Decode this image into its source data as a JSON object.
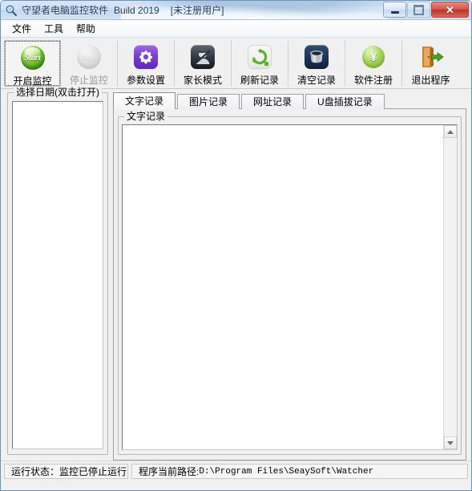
{
  "window": {
    "title": "守望者电脑监控软件",
    "build": "Build 2019",
    "registration": "[未注册用户]",
    "icon": "magnifier-icon",
    "caption": {
      "minimize": "—",
      "maximize": "□",
      "close": "✕"
    }
  },
  "menu": {
    "items": [
      {
        "label": "文件"
      },
      {
        "label": "工具"
      },
      {
        "label": "帮助"
      }
    ]
  },
  "toolbar": {
    "buttons": [
      {
        "label": "开启监控",
        "icon": "start-icon",
        "icon_text": "Start",
        "state": "focused"
      },
      {
        "label": "停止监控",
        "icon": "stop-icon",
        "icon_text": "Stop",
        "state": "disabled"
      },
      {
        "label": "参数设置",
        "icon": "gear-icon",
        "state": "normal"
      },
      {
        "label": "家长模式",
        "icon": "parent-mode-icon",
        "state": "normal"
      },
      {
        "label": "刷新记录",
        "icon": "refresh-icon",
        "state": "normal"
      },
      {
        "label": "清空记录",
        "icon": "trash-icon",
        "state": "normal"
      },
      {
        "label": "软件注册",
        "icon": "yen-coin-icon",
        "icon_text": "¥",
        "state": "normal"
      },
      {
        "label": "退出程序",
        "icon": "exit-door-icon",
        "state": "normal"
      }
    ]
  },
  "date_panel": {
    "title": "选择日期(双击打开)",
    "items": []
  },
  "tabs": [
    {
      "label": "文字记录",
      "active": true
    },
    {
      "label": "图片记录",
      "active": false
    },
    {
      "label": "网址记录",
      "active": false
    },
    {
      "label": "U盘插拔记录",
      "active": false
    }
  ],
  "record_panel": {
    "title": "文字记录",
    "content": ""
  },
  "statusbar": {
    "run_state": "运行状态：监控已停止运行",
    "path_label": "程序当前路径:",
    "path_value": "D:\\Program Files\\SeaySoft\\Watcher"
  },
  "colors": {
    "title_bar": "#cfe0f2",
    "close_button": "#c0392b",
    "start_green": "#3f9e17",
    "gear_purple": "#7b3fd4",
    "window_bg": "#f0f0f0"
  }
}
